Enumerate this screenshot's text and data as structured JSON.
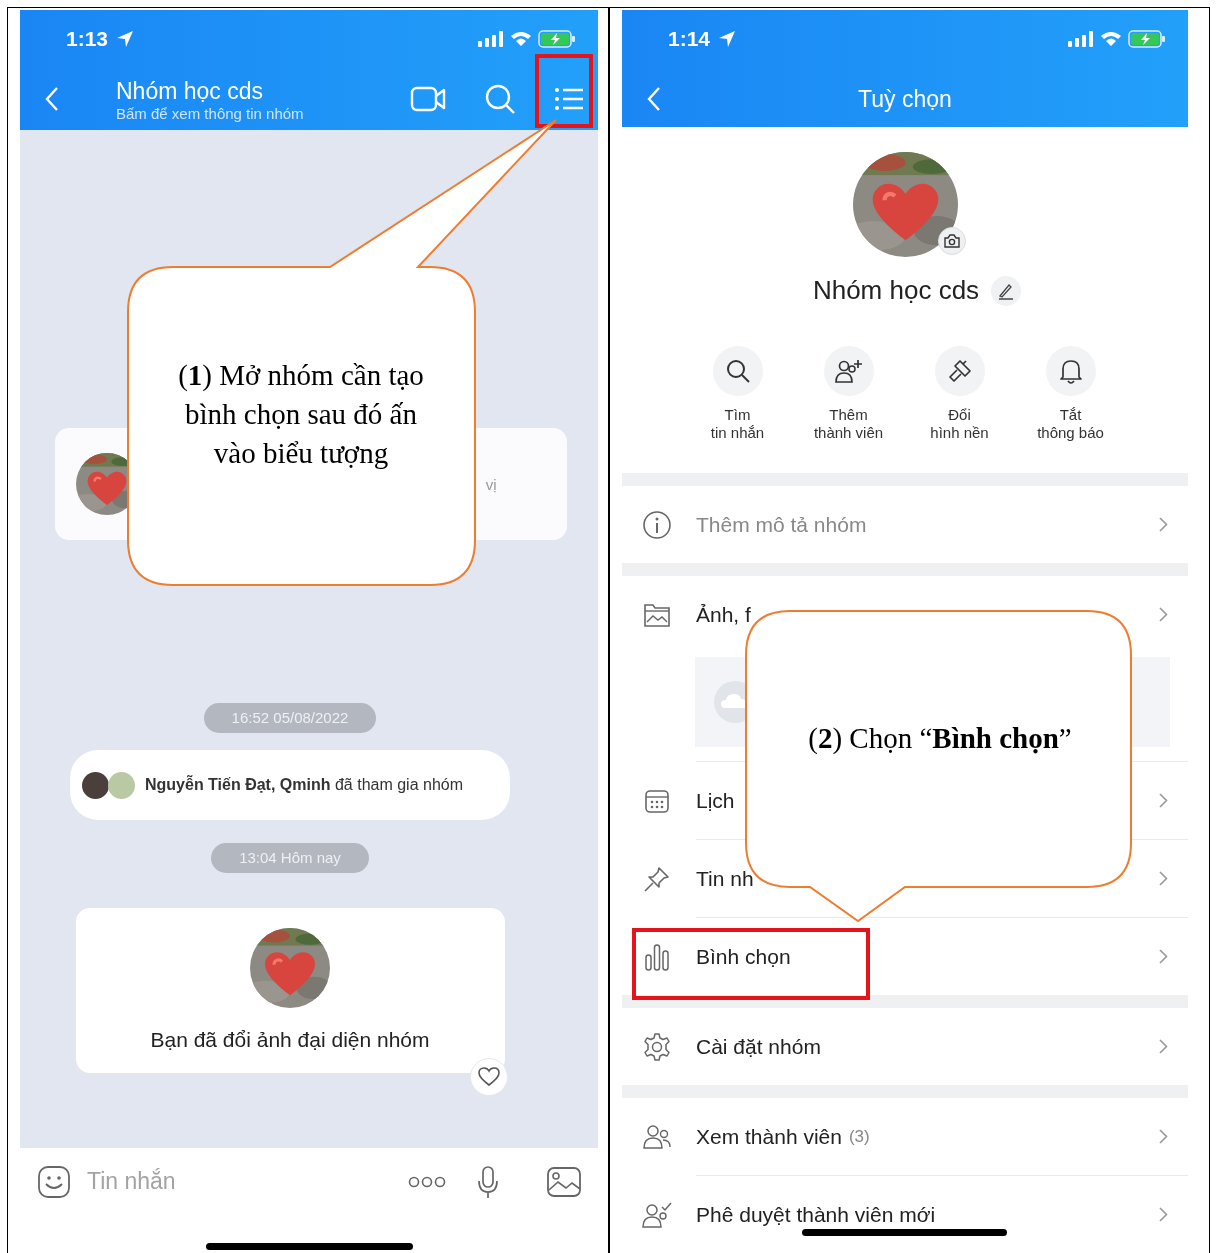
{
  "chat_screen": {
    "status_time": "1:13",
    "header": {
      "title": "Nhóm học cds",
      "subtitle": "Bấm để xem thông tin nhóm",
      "menu_highlighted": true
    },
    "messages": [
      {
        "kind": "card",
        "text": "vị"
      },
      {
        "kind": "time",
        "text": "16:52 05/08/2022"
      },
      {
        "kind": "system",
        "text": "**Nguyễn Tiến Đạt, Qminh** đã tham gia nhóm"
      },
      {
        "kind": "time",
        "text": "13:04 Hôm nay"
      },
      {
        "kind": "photo_notice",
        "text": "Bạn đã đổi ảnh đại diện nhóm"
      }
    ],
    "composer": {
      "placeholder": "Tin nhắn"
    }
  },
  "options_screen": {
    "status_time": "1:14",
    "title": "Tuỳ chọn",
    "group_name": "Nhóm học cds",
    "actions": [
      {
        "kind": "search",
        "lines": [
          "Tìm",
          "tin nhắn"
        ]
      },
      {
        "kind": "add_member",
        "lines": [
          "Thêm",
          "thành viên"
        ]
      },
      {
        "kind": "wallpaper",
        "lines": [
          "Đổi",
          "hình nền"
        ]
      },
      {
        "kind": "bell",
        "lines": [
          "Tắt",
          "thông báo"
        ]
      }
    ],
    "sections": [
      {
        "items": [
          {
            "kind": "info",
            "label": "Thêm mô tả nhóm",
            "muted": true,
            "highlighted": false
          }
        ]
      },
      {
        "items": [
          {
            "kind": "media",
            "label": "Ảnh, f",
            "muted": false,
            "highlighted": false
          },
          {
            "kind": "calendar",
            "label": "Lịch",
            "muted": false,
            "highlighted": false
          },
          {
            "kind": "pin",
            "label": "Tin nh",
            "muted": false,
            "highlighted": false
          },
          {
            "kind": "poll",
            "label": "Bình chọn",
            "muted": false,
            "highlighted": true
          }
        ]
      },
      {
        "items": [
          {
            "kind": "settings",
            "label": "Cài đặt nhóm",
            "muted": false,
            "highlighted": false
          }
        ]
      },
      {
        "items": [
          {
            "kind": "members",
            "label": "Xem thành viên",
            "count": "(3)",
            "muted": false,
            "highlighted": false
          },
          {
            "kind": "approve",
            "label": "Phê duyệt thành viên mới",
            "muted": false,
            "highlighted": false
          }
        ]
      }
    ]
  },
  "callouts": [
    {
      "text": "(**1**) Mở nhóm cần tạo bình chọn sau đó ấn vào biểu tượng"
    },
    {
      "text": "(**2**) Chọn “**Bình chọn**”"
    }
  ]
}
